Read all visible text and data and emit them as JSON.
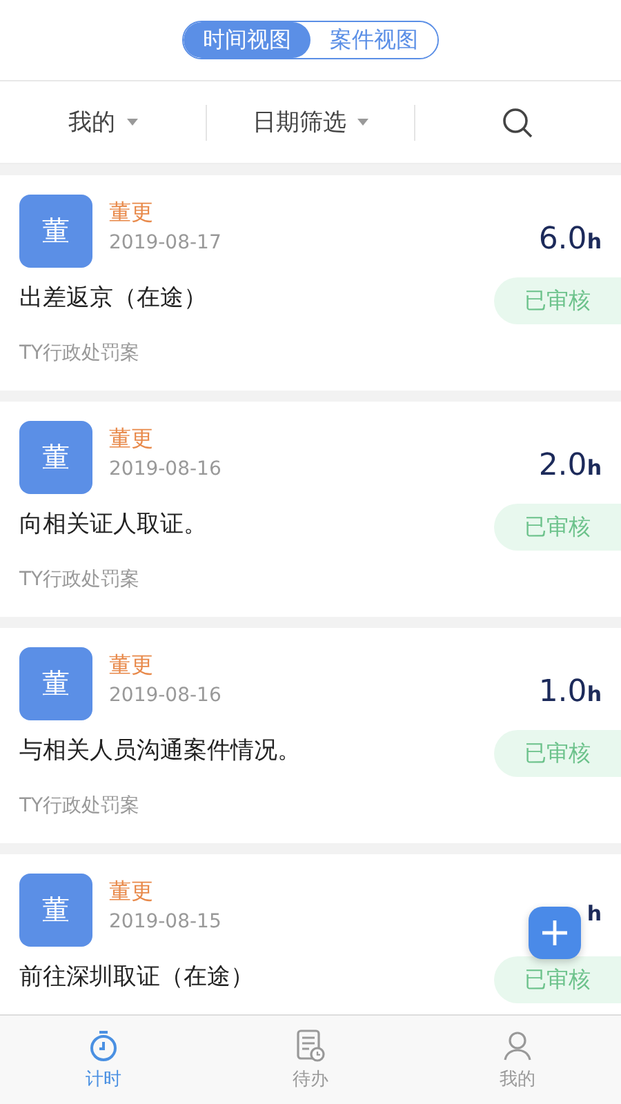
{
  "view_switch": [
    {
      "label": "时间视图",
      "selected": true
    },
    {
      "label": "案件视图",
      "selected": false
    }
  ],
  "filters": [
    {
      "label": "我的"
    },
    {
      "label": "日期筛选"
    }
  ],
  "entries": [
    {
      "avatar": "董",
      "name": "董更",
      "date": "2019-08-17",
      "hours": "6.0",
      "unit": "h",
      "status": "已审核",
      "description": "出差返京（在途）",
      "case": "TY行政处罚案"
    },
    {
      "avatar": "董",
      "name": "董更",
      "date": "2019-08-16",
      "hours": "2.0",
      "unit": "h",
      "status": "已审核",
      "description": "向相关证人取证。",
      "case": "TY行政处罚案"
    },
    {
      "avatar": "董",
      "name": "董更",
      "date": "2019-08-16",
      "hours": "1.0",
      "unit": "h",
      "status": "已审核",
      "description": "与相关人员沟通案件情况。",
      "case": "TY行政处罚案"
    },
    {
      "avatar": "董",
      "name": "董更",
      "date": "2019-08-15",
      "unit": "h",
      "status": "已审核",
      "description": "前往深圳取证（在途）"
    }
  ],
  "tab_bar": [
    {
      "label": "计时",
      "kind": "timer",
      "selected": true
    },
    {
      "label": "待办",
      "kind": "todo",
      "selected": false
    },
    {
      "label": "我的",
      "kind": "me",
      "selected": false
    }
  ]
}
